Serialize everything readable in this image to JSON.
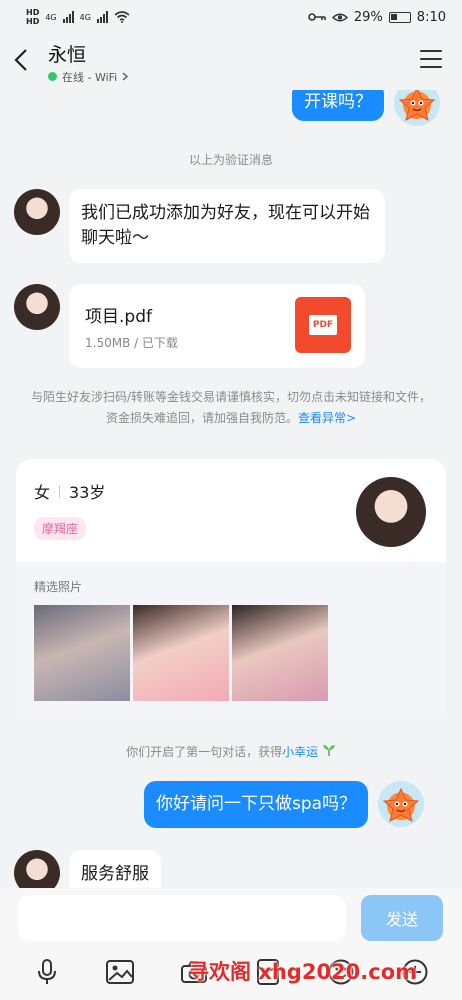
{
  "status_bar": {
    "hd1": "HD",
    "hd2": "HD",
    "net1": "4G",
    "net2": "4G",
    "battery": "29%",
    "time": "8:10"
  },
  "header": {
    "title": "永恒",
    "presence": "在线 - WiFi",
    "presence_color": "#35c86b"
  },
  "messages": {
    "out_top": "开课吗？",
    "sys_verify": "以上为验证消息",
    "in_friend": "我们已成功添加为好友，现在可以开始聊天啦～",
    "file": {
      "name": "项目.pdf",
      "meta": "1.50MB / 已下载",
      "badge": "PDF"
    },
    "warning": "与陌生好友涉扫码/转账等金钱交易请谨慎核实，切勿点击未知链接和文件，资金损失难追回，请加强自我防范。",
    "warning_link": "查看异常>",
    "sys_first_chat": "你们开启了第一句对话，获得",
    "sys_first_chat_link": "小幸运",
    "out_bottom": "你好请问一下只做spa吗？",
    "in_last": "服务舒服"
  },
  "profile_card": {
    "gender": "女",
    "age": "33岁",
    "tag": "摩羯座",
    "photos_label": "精选照片"
  },
  "input_bar": {
    "placeholder": "",
    "send_label": "发送"
  },
  "tools": [
    "microphone-icon",
    "image-icon",
    "camera-icon",
    "red-packet-icon",
    "emoji-icon",
    "plus-icon"
  ],
  "watermark": "寻欢阁 xhg2020.com",
  "colors": {
    "accent": "#1a8cff",
    "send_disabled": "#8cc6f7",
    "pdf": "#f24a2e",
    "tag_bg": "#fde6ef",
    "tag_text": "#e8669a"
  }
}
